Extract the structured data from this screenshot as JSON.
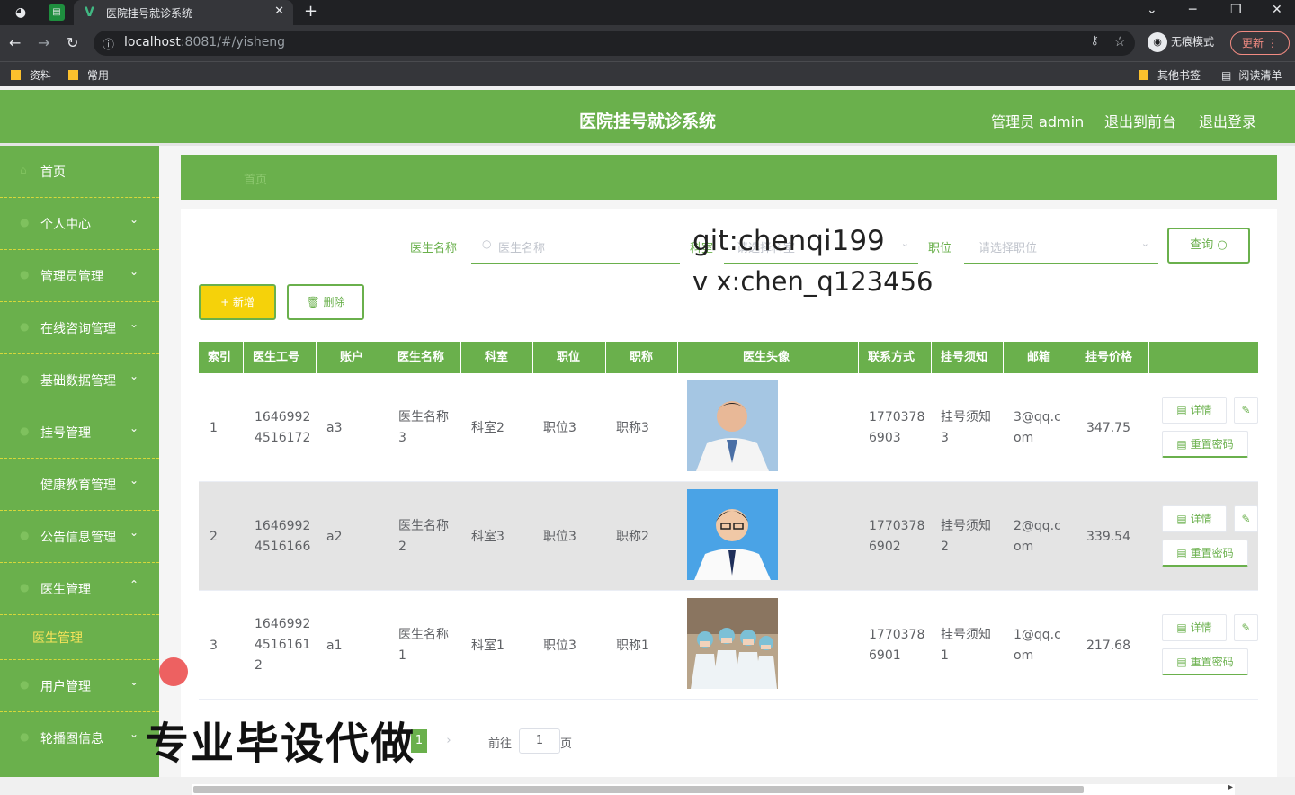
{
  "browser": {
    "tab_title": "医院挂号就诊系统",
    "url_host": "localhost",
    "url_rest": ":8081/#/yisheng",
    "incognito_label": "无痕模式",
    "update_label": "更新",
    "bookmarks": [
      "资料",
      "常用"
    ],
    "other_bookmarks": "其他书签",
    "reading_list": "阅读清单"
  },
  "header": {
    "title": "医院挂号就诊系统",
    "admin": "管理员 admin",
    "back_front": "退出到前台",
    "logout": "退出登录"
  },
  "sidebar": {
    "items": [
      {
        "label": "首页",
        "chevron": ""
      },
      {
        "label": "个人中心",
        "chevron": "⌄"
      },
      {
        "label": "管理员管理",
        "chevron": "⌄"
      },
      {
        "label": "在线咨询管理",
        "chevron": "⌄"
      },
      {
        "label": "基础数据管理",
        "chevron": "⌄"
      },
      {
        "label": "挂号管理",
        "chevron": "⌄"
      },
      {
        "label": "健康教育管理",
        "chevron": "⌄"
      },
      {
        "label": "公告信息管理",
        "chevron": "⌄"
      },
      {
        "label": "医生管理",
        "chevron": "⌃"
      }
    ],
    "sub_item": "医生管理",
    "after_items": [
      {
        "label": "用户管理",
        "chevron": "⌄"
      },
      {
        "label": "轮播图信息",
        "chevron": "⌄"
      }
    ]
  },
  "breadcrumb": "首页",
  "search": {
    "name_label": "医生名称",
    "name_placeholder": "医生名称",
    "dept_label": "科室",
    "dept_placeholder": "请选择科室",
    "pos_label": "职位",
    "pos_placeholder": "请选择职位",
    "query_label": "查询 ○"
  },
  "actions": {
    "add": "+ 新增",
    "delete": "🗑 删除"
  },
  "table": {
    "headers": [
      "索引",
      "医生工号",
      "账户",
      "医生名称",
      "科室",
      "职位",
      "职称",
      "医生头像",
      "联系方式",
      "挂号须知",
      "邮箱",
      "挂号价格"
    ],
    "rows": [
      {
        "idx": "1",
        "no1": "1646992",
        "no2": "4516172",
        "no3": "",
        "acct": "a3",
        "name1": "医生名称",
        "name2": "3",
        "dept": "科室2",
        "pos": "职位3",
        "title": "职称3",
        "tel1": "1770378",
        "tel2": "6903",
        "note1": "挂号须知",
        "note2": "3",
        "mail1": "3@qq.c",
        "mail2": "om",
        "price": "347.75"
      },
      {
        "idx": "2",
        "no1": "1646992",
        "no2": "4516166",
        "no3": "",
        "acct": "a2",
        "name1": "医生名称",
        "name2": "2",
        "dept": "科室3",
        "pos": "职位3",
        "title": "职称2",
        "tel1": "1770378",
        "tel2": "6902",
        "note1": "挂号须知",
        "note2": "2",
        "mail1": "2@qq.c",
        "mail2": "om",
        "price": "339.54"
      },
      {
        "idx": "3",
        "no1": "1646992",
        "no2": "4516161",
        "no3": "2",
        "acct": "a1",
        "name1": "医生名称",
        "name2": "1",
        "dept": "科室1",
        "pos": "职位3",
        "title": "职称1",
        "tel1": "1770378",
        "tel2": "6901",
        "note1": "挂号须知",
        "note2": "1",
        "mail1": "1@qq.c",
        "mail2": "om",
        "price": "217.68"
      }
    ],
    "detail_label": "▤ 详情",
    "reset_label": "▤ 重置密码"
  },
  "pager": {
    "page": "1",
    "goto": "前往",
    "page_suffix": "页",
    "input": "1"
  },
  "overlays": {
    "line1": "git:chenqi199",
    "line2": "v x:chen_q123456",
    "banner": "专业毕设代做"
  },
  "colors": {
    "brand": "#6ab04c",
    "accent": "#f5d20a"
  }
}
